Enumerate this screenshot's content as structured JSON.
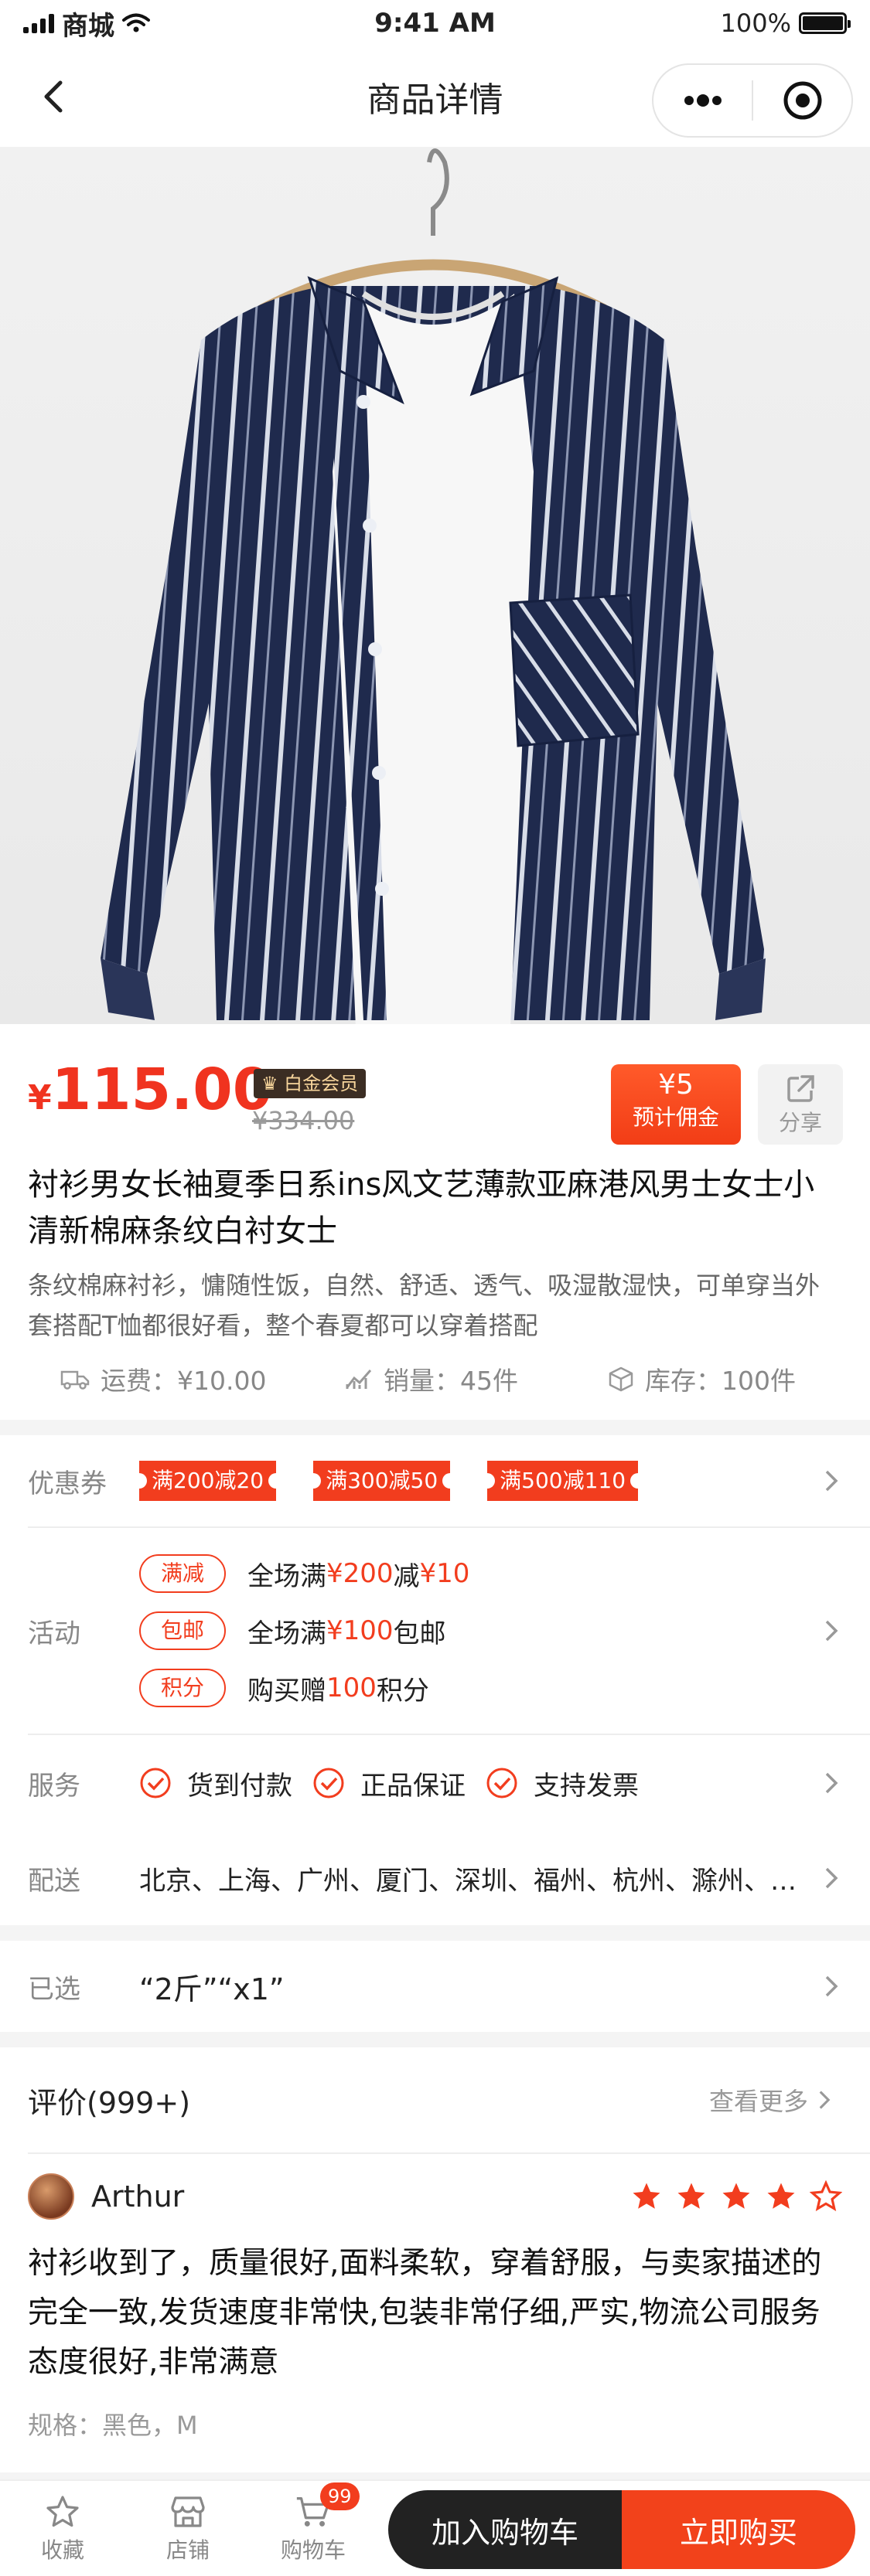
{
  "status_bar": {
    "carrier": "商城",
    "time": "9:41 AM",
    "battery": "100%"
  },
  "nav": {
    "title": "商品详情"
  },
  "price": {
    "currency": "¥",
    "current": "115.00",
    "member_tag": "白金会员",
    "original": "¥334.00",
    "commission_value": "¥5",
    "commission_label": "预计佣金",
    "share_label": "分享"
  },
  "product": {
    "title": "衬衫男女长袖夏季日系ins风文艺薄款亚麻港风男士女士小清新棉麻条纹白衬女士",
    "description": "条纹棉麻衬衫，慵随性饭，自然、舒适、透气、吸湿散湿快，可单穿当外套搭配T恤都很好看，整个春夏都可以穿着搭配",
    "shipping": "运费：¥10.00",
    "sales": "销量：45件",
    "stock": "库存：100件"
  },
  "coupons": {
    "label": "优惠券",
    "items": [
      "满200减20",
      "满300减50",
      "满500减110"
    ]
  },
  "activities": {
    "label": "活动",
    "items": [
      {
        "tag": "满减",
        "pre": "全场满",
        "red1": "¥200",
        "mid": "减",
        "red2": "¥10",
        "post": ""
      },
      {
        "tag": "包邮",
        "pre": "全场满",
        "red1": "¥100",
        "mid": "包邮",
        "red2": "",
        "post": ""
      },
      {
        "tag": "积分",
        "pre": "购买赠",
        "red1": "100",
        "mid": "积分",
        "red2": "",
        "post": ""
      }
    ]
  },
  "services": {
    "label": "服务",
    "items": [
      "货到付款",
      "正品保证",
      "支持发票"
    ]
  },
  "delivery": {
    "label": "配送",
    "text": "北京、上海、广州、厦门、深圳、福州、杭州、滁州、南京、武汉"
  },
  "selected": {
    "label": "已选",
    "text": "“2斤”“x1”"
  },
  "reviews": {
    "title": "评价(999+)",
    "more": "查看更多",
    "user": "Arthur",
    "rating": 4,
    "text": "衬衫收到了，质量很好,面料柔软，穿着舒服，与卖家描述的完全一致,发货速度非常快,包装非常仔细,严实,物流公司服务态度很好,非常满意",
    "spec": "规格：黑色，M"
  },
  "bottom_bar": {
    "favorite": "收藏",
    "store": "店铺",
    "cart": "购物车",
    "cart_badge": "99",
    "add_to_cart": "加入购物车",
    "buy_now": "立即购买"
  },
  "colors": {
    "accent": "#f23d1e",
    "dark": "#222222",
    "vip_bg": "#3b2d23",
    "vip_text": "#f7d59b"
  }
}
